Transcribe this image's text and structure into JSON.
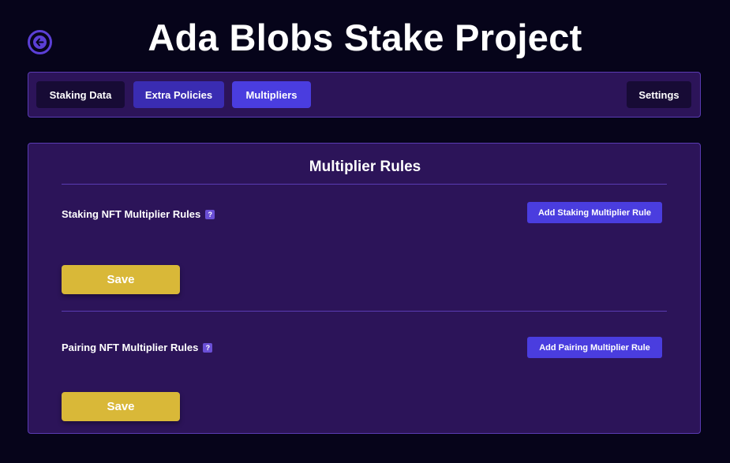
{
  "header": {
    "title": "Ada Blobs Stake Project",
    "back_icon": "arrow-left-circle-icon"
  },
  "tabs": {
    "staking_data": "Staking Data",
    "extra_policies": "Extra Policies",
    "multipliers": "Multipliers",
    "settings": "Settings"
  },
  "panel": {
    "title": "Multiplier Rules",
    "staking": {
      "label": "Staking NFT Multiplier Rules",
      "help": "?",
      "add_button": "Add Staking Multiplier Rule",
      "save_button": "Save"
    },
    "pairing": {
      "label": "Pairing NFT Multiplier Rules",
      "help": "?",
      "add_button": "Add Pairing Multiplier Rule",
      "save_button": "Save"
    }
  },
  "colors": {
    "background": "#06041a",
    "panel": "#2c1459",
    "accent": "#4a3ddf",
    "save": "#d9b838"
  }
}
